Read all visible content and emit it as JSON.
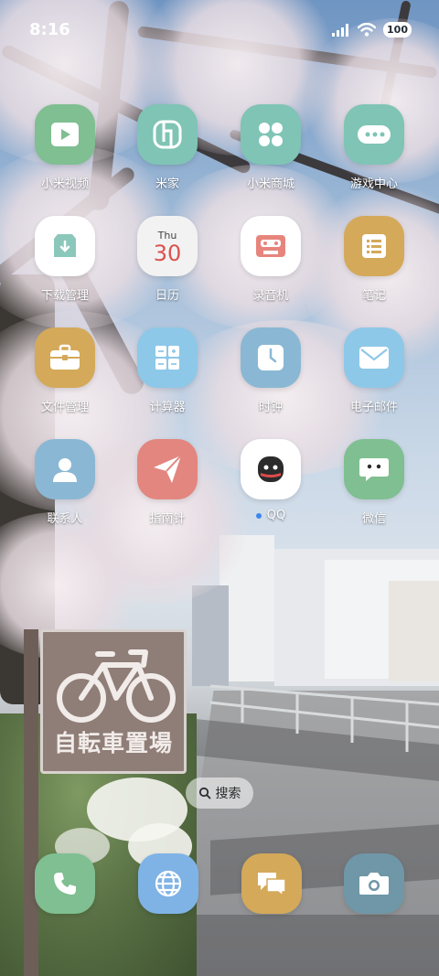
{
  "status_bar": {
    "time": "8:16",
    "battery": "100"
  },
  "apps": [
    {
      "label": "小米视频",
      "icon": "play-icon",
      "color": "#7fbf91"
    },
    {
      "label": "米家",
      "icon": "mijia-icon",
      "color": "#7fc4b5"
    },
    {
      "label": "小米商城",
      "icon": "grid-dots-icon",
      "color": "#7fc4b5"
    },
    {
      "label": "游戏中心",
      "icon": "gamepad-icon",
      "color": "#7fc4b5"
    },
    {
      "label": "下载管理",
      "icon": "download-box-icon",
      "color": "#ffffff"
    },
    {
      "label": "日历",
      "icon": "calendar-icon",
      "color": "#f2f2f2",
      "day_name": "Thu",
      "day_number": "30"
    },
    {
      "label": "录音机",
      "icon": "cassette-icon",
      "color": "#ffffff"
    },
    {
      "label": "笔记",
      "icon": "notes-icon",
      "color": "#d4a95a"
    },
    {
      "label": "文件管理",
      "icon": "briefcase-icon",
      "color": "#d4a95a"
    },
    {
      "label": "计算器",
      "icon": "calculator-icon",
      "color": "#8ec8e8"
    },
    {
      "label": "时钟",
      "icon": "clock-icon",
      "color": "#8ab8d4"
    },
    {
      "label": "电子邮件",
      "icon": "mail-icon",
      "color": "#8ec8e8"
    },
    {
      "label": "联系人",
      "icon": "contact-icon",
      "color": "#8ab8d4"
    },
    {
      "label": "指南针",
      "icon": "paper-plane-icon",
      "color": "#e3867f"
    },
    {
      "label": "QQ",
      "icon": "qq-icon",
      "color": "#ffffff",
      "has_notification_dot": true
    },
    {
      "label": "微信",
      "icon": "wechat-icon",
      "color": "#7fbf91"
    }
  ],
  "search": {
    "label": "搜索",
    "icon": "search-icon"
  },
  "dock": [
    {
      "icon": "phone-icon",
      "color": "#7fbf91"
    },
    {
      "icon": "globe-icon",
      "color": "#7fb3e6"
    },
    {
      "icon": "chat-bubbles-icon",
      "color": "#d4a95a"
    },
    {
      "icon": "camera-icon",
      "color": "#6f97a8"
    }
  ],
  "wallpaper": {
    "sign_text": "自転車置場"
  }
}
